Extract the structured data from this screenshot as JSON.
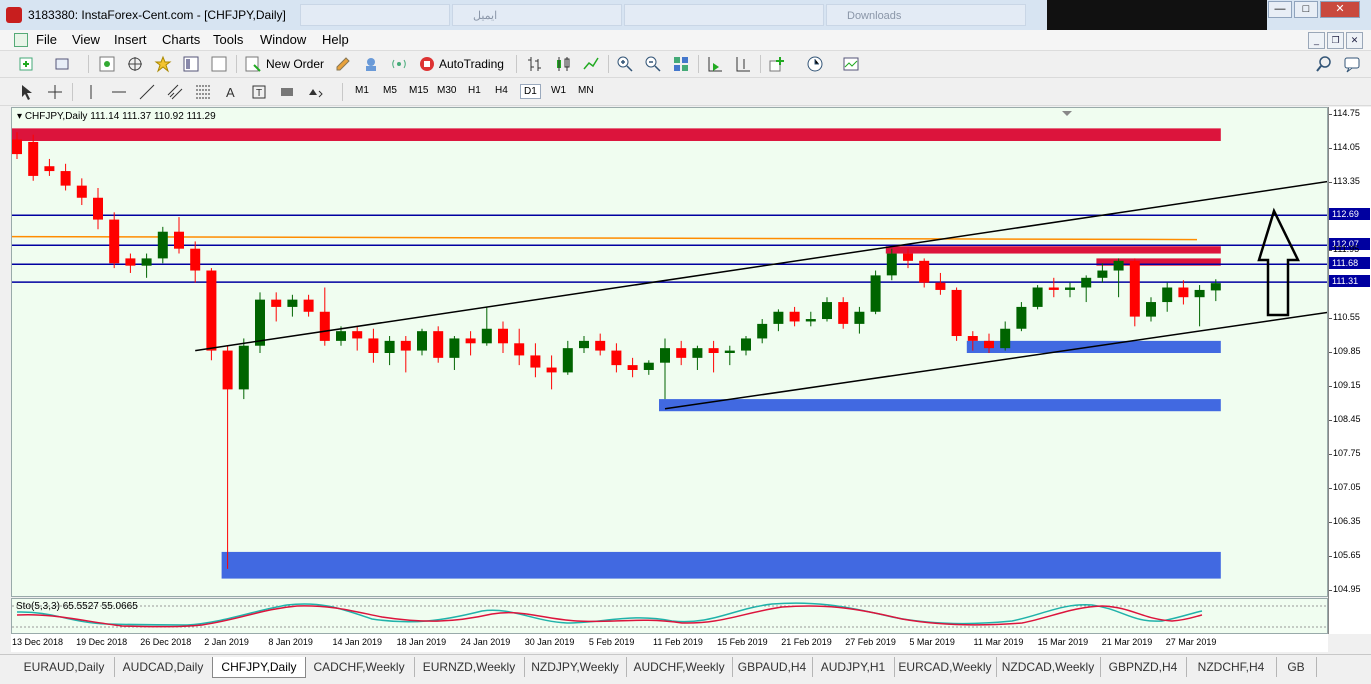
{
  "window": {
    "title": "3183380: InstaForex-Cent.com - [CHFJPY,Daily]"
  },
  "browser_tabs_ghost": [
    "ایمیل",
    "Downloads"
  ],
  "menu": [
    "File",
    "Insert",
    "Charts",
    "Tools",
    "Window",
    "Help"
  ],
  "menu_view": "View",
  "toolbar1": {
    "new_order": "New Order",
    "autotrading": "AutoTrading"
  },
  "timeframes": [
    "M1",
    "M5",
    "M15",
    "M30",
    "H1",
    "H4",
    "D1",
    "W1",
    "MN"
  ],
  "active_timeframe": "D1",
  "chart": {
    "symbol_header": "CHFJPY,Daily  111.14 111.37 110.92 111.29",
    "oscillator_header": "Sto(5,3,3) 65.5527 55.0665",
    "osc_scale": [
      "80",
      "20"
    ],
    "price_labels": [
      "114.75",
      "114.05",
      "113.35",
      "112.69",
      "112.07",
      "111.95",
      "111.68",
      "111.31",
      "110.55",
      "109.85",
      "109.15",
      "108.45",
      "107.75",
      "107.05",
      "106.35",
      "105.65",
      "104.95"
    ],
    "price_tags": [
      "112.69",
      "112.07",
      "111.68",
      "111.31"
    ],
    "time_labels": [
      "13 Dec 2018",
      "19 Dec 2018",
      "26 Dec 2018",
      "2 Jan 2019",
      "8 Jan 2019",
      "14 Jan 2019",
      "18 Jan 2019",
      "24 Jan 2019",
      "30 Jan 2019",
      "5 Feb 2019",
      "11 Feb 2019",
      "15 Feb 2019",
      "21 Feb 2019",
      "27 Feb 2019",
      "5 Mar 2019",
      "11 Mar 2019",
      "15 Mar 2019",
      "21 Mar 2019",
      "27 Mar 2019"
    ]
  },
  "colors": {
    "bull": "#006400",
    "bear": "#ff0000",
    "level": "#0000a0",
    "resistance_zone": "#dc143c",
    "support_zone": "#4169e1",
    "ma": "#ff8c00",
    "chart_bg": "#f0fdf0"
  },
  "tabs": [
    "EURAUD,Daily",
    "AUDCAD,Daily",
    "CHFJPY,Daily",
    "CADCHF,Weekly",
    "EURNZD,Weekly",
    "NZDJPY,Weekly",
    "AUDCHF,Weekly",
    "GBPAUD,H4",
    "AUDJPY,H1",
    "EURCAD,Weekly",
    "NZDCAD,Weekly",
    "GBPNZD,H4",
    "NZDCHF,H4",
    "GB"
  ],
  "active_tab": "CHFJPY,Daily",
  "chart_data": {
    "type": "candlestick",
    "candles": [
      {
        "o": 114.25,
        "h": 114.4,
        "c": 113.95,
        "l": 113.85
      },
      {
        "o": 114.2,
        "h": 114.35,
        "c": 113.5,
        "l": 113.4
      },
      {
        "o": 113.7,
        "h": 113.85,
        "c": 113.6,
        "l": 113.5
      },
      {
        "o": 113.6,
        "h": 113.75,
        "c": 113.3,
        "l": 113.2
      },
      {
        "o": 113.3,
        "h": 113.45,
        "c": 113.05,
        "l": 112.9
      },
      {
        "o": 113.05,
        "h": 113.25,
        "c": 112.6,
        "l": 112.4
      },
      {
        "o": 112.6,
        "h": 112.75,
        "c": 111.7,
        "l": 111.6
      },
      {
        "o": 111.8,
        "h": 111.9,
        "c": 111.65,
        "l": 111.5
      },
      {
        "o": 111.65,
        "h": 111.9,
        "c": 111.8,
        "l": 111.4
      },
      {
        "o": 111.8,
        "h": 112.45,
        "c": 112.35,
        "l": 111.7
      },
      {
        "o": 112.35,
        "h": 112.65,
        "c": 112.0,
        "l": 111.9
      },
      {
        "o": 112.0,
        "h": 112.15,
        "c": 111.55,
        "l": 111.3
      },
      {
        "o": 111.55,
        "h": 111.6,
        "c": 109.9,
        "l": 109.7
      },
      {
        "o": 109.9,
        "h": 110.0,
        "c": 109.1,
        "l": 105.4
      },
      {
        "o": 109.1,
        "h": 110.15,
        "c": 110.0,
        "l": 108.9
      },
      {
        "o": 110.0,
        "h": 111.1,
        "c": 110.95,
        "l": 109.85
      },
      {
        "o": 110.95,
        "h": 111.1,
        "c": 110.8,
        "l": 110.5
      },
      {
        "o": 110.8,
        "h": 111.05,
        "c": 110.95,
        "l": 110.6
      },
      {
        "o": 110.95,
        "h": 111.05,
        "c": 110.7,
        "l": 110.6
      },
      {
        "o": 110.7,
        "h": 111.2,
        "c": 110.1,
        "l": 110.0
      },
      {
        "o": 110.1,
        "h": 110.4,
        "c": 110.3,
        "l": 110.0
      },
      {
        "o": 110.3,
        "h": 110.4,
        "c": 110.15,
        "l": 109.9
      },
      {
        "o": 110.15,
        "h": 110.35,
        "c": 109.85,
        "l": 109.65
      },
      {
        "o": 109.85,
        "h": 110.2,
        "c": 110.1,
        "l": 109.6
      },
      {
        "o": 110.1,
        "h": 110.2,
        "c": 109.9,
        "l": 109.45
      },
      {
        "o": 109.9,
        "h": 110.35,
        "c": 110.3,
        "l": 109.8
      },
      {
        "o": 110.3,
        "h": 110.4,
        "c": 109.75,
        "l": 109.65
      },
      {
        "o": 109.75,
        "h": 110.2,
        "c": 110.15,
        "l": 109.5
      },
      {
        "o": 110.15,
        "h": 110.3,
        "c": 110.05,
        "l": 109.8
      },
      {
        "o": 110.05,
        "h": 110.8,
        "c": 110.35,
        "l": 110.0
      },
      {
        "o": 110.35,
        "h": 110.5,
        "c": 110.05,
        "l": 109.85
      },
      {
        "o": 110.05,
        "h": 110.35,
        "c": 109.8,
        "l": 109.6
      },
      {
        "o": 109.8,
        "h": 110.05,
        "c": 109.55,
        "l": 109.35
      },
      {
        "o": 109.55,
        "h": 109.8,
        "c": 109.45,
        "l": 109.1
      },
      {
        "o": 109.45,
        "h": 110.1,
        "c": 109.95,
        "l": 109.4
      },
      {
        "o": 109.95,
        "h": 110.2,
        "c": 110.1,
        "l": 109.85
      },
      {
        "o": 110.1,
        "h": 110.25,
        "c": 109.9,
        "l": 109.8
      },
      {
        "o": 109.9,
        "h": 110.05,
        "c": 109.6,
        "l": 109.45
      },
      {
        "o": 109.6,
        "h": 109.75,
        "c": 109.5,
        "l": 109.35
      },
      {
        "o": 109.5,
        "h": 109.7,
        "c": 109.65,
        "l": 109.4
      },
      {
        "o": 109.65,
        "h": 110.15,
        "c": 109.95,
        "l": 108.9
      },
      {
        "o": 109.95,
        "h": 110.1,
        "c": 109.75,
        "l": 109.6
      },
      {
        "o": 109.75,
        "h": 110.0,
        "c": 109.95,
        "l": 109.5
      },
      {
        "o": 109.95,
        "h": 110.1,
        "c": 109.85,
        "l": 109.45
      },
      {
        "o": 109.85,
        "h": 110.0,
        "c": 109.9,
        "l": 109.6
      },
      {
        "o": 109.9,
        "h": 110.2,
        "c": 110.15,
        "l": 109.8
      },
      {
        "o": 110.15,
        "h": 110.55,
        "c": 110.45,
        "l": 110.05
      },
      {
        "o": 110.45,
        "h": 110.75,
        "c": 110.7,
        "l": 110.3
      },
      {
        "o": 110.7,
        "h": 110.8,
        "c": 110.5,
        "l": 110.4
      },
      {
        "o": 110.5,
        "h": 110.7,
        "c": 110.55,
        "l": 110.4
      },
      {
        "o": 110.55,
        "h": 111.0,
        "c": 110.9,
        "l": 110.5
      },
      {
        "o": 110.9,
        "h": 111.0,
        "c": 110.45,
        "l": 110.35
      },
      {
        "o": 110.45,
        "h": 110.8,
        "c": 110.7,
        "l": 110.25
      },
      {
        "o": 110.7,
        "h": 111.55,
        "c": 111.45,
        "l": 110.65
      },
      {
        "o": 111.45,
        "h": 112.0,
        "c": 111.9,
        "l": 111.35
      },
      {
        "o": 111.9,
        "h": 112.0,
        "c": 111.75,
        "l": 111.6
      },
      {
        "o": 111.75,
        "h": 111.8,
        "c": 111.3,
        "l": 111.2
      },
      {
        "o": 111.3,
        "h": 111.5,
        "c": 111.15,
        "l": 111.05
      },
      {
        "o": 111.15,
        "h": 111.2,
        "c": 110.2,
        "l": 110.1
      },
      {
        "o": 110.2,
        "h": 110.3,
        "c": 110.1,
        "l": 109.9
      },
      {
        "o": 110.1,
        "h": 110.25,
        "c": 109.95,
        "l": 109.85
      },
      {
        "o": 109.95,
        "h": 110.5,
        "c": 110.35,
        "l": 109.9
      },
      {
        "o": 110.35,
        "h": 110.9,
        "c": 110.8,
        "l": 110.3
      },
      {
        "o": 110.8,
        "h": 111.25,
        "c": 111.2,
        "l": 110.75
      },
      {
        "o": 111.2,
        "h": 111.4,
        "c": 111.15,
        "l": 111.0
      },
      {
        "o": 111.15,
        "h": 111.3,
        "c": 111.2,
        "l": 111.0
      },
      {
        "o": 111.2,
        "h": 111.45,
        "c": 111.4,
        "l": 110.9
      },
      {
        "o": 111.4,
        "h": 111.7,
        "c": 111.55,
        "l": 111.3
      },
      {
        "o": 111.55,
        "h": 111.8,
        "c": 111.75,
        "l": 111.0
      },
      {
        "o": 111.75,
        "h": 111.8,
        "c": 110.6,
        "l": 110.4
      },
      {
        "o": 110.6,
        "h": 111.0,
        "c": 110.9,
        "l": 110.5
      },
      {
        "o": 110.9,
        "h": 111.3,
        "c": 111.2,
        "l": 110.7
      },
      {
        "o": 111.2,
        "h": 111.35,
        "c": 111.0,
        "l": 110.85
      },
      {
        "o": 111.0,
        "h": 111.25,
        "c": 111.15,
        "l": 110.4
      },
      {
        "o": 111.14,
        "h": 111.37,
        "c": 111.29,
        "l": 110.92
      }
    ],
    "x_labels": [
      "13 Dec 2018",
      "19 Dec 2018",
      "26 Dec 2018",
      "2 Jan 2019",
      "8 Jan 2019",
      "14 Jan 2019",
      "18 Jan 2019",
      "24 Jan 2019",
      "30 Jan 2019",
      "5 Feb 2019",
      "11 Feb 2019",
      "15 Feb 2019",
      "21 Feb 2019",
      "27 Feb 2019",
      "5 Mar 2019",
      "11 Mar 2019",
      "15 Mar 2019",
      "21 Mar 2019",
      "27 Mar 2019"
    ],
    "y_range": [
      104.8,
      114.9
    ],
    "horizontal_levels": [
      112.69,
      112.07,
      111.68,
      111.31
    ],
    "ma_level": 112.25,
    "zones": [
      {
        "kind": "resistance",
        "from_bar": 0,
        "to_bar": 74,
        "top": 114.48,
        "bottom": 114.22
      },
      {
        "kind": "resistance",
        "from_bar": 54,
        "to_bar": 74,
        "top": 112.05,
        "bottom": 111.9
      },
      {
        "kind": "resistance",
        "from_bar": 67,
        "to_bar": 74,
        "top": 111.8,
        "bottom": 111.65
      },
      {
        "kind": "support",
        "from_bar": 59,
        "to_bar": 74,
        "top": 110.1,
        "bottom": 109.85
      },
      {
        "kind": "support",
        "from_bar": 40,
        "to_bar": 74,
        "top": 108.9,
        "bottom": 108.65
      },
      {
        "kind": "support",
        "from_bar": 13,
        "to_bar": 74,
        "top": 105.75,
        "bottom": 105.2
      }
    ],
    "trendlines": [
      {
        "from_bar": 11,
        "from_price": 109.9,
        "to_bar": 82,
        "to_price": 113.5
      },
      {
        "from_bar": 40,
        "from_price": 108.7,
        "to_bar": 82,
        "to_price": 110.8
      }
    ],
    "oscillator": {
      "type": "stochastic",
      "k_period": 5,
      "d_period": 3,
      "slowing": 3,
      "k": 65.5527,
      "d": 55.0665,
      "levels": [
        20,
        80
      ]
    }
  }
}
